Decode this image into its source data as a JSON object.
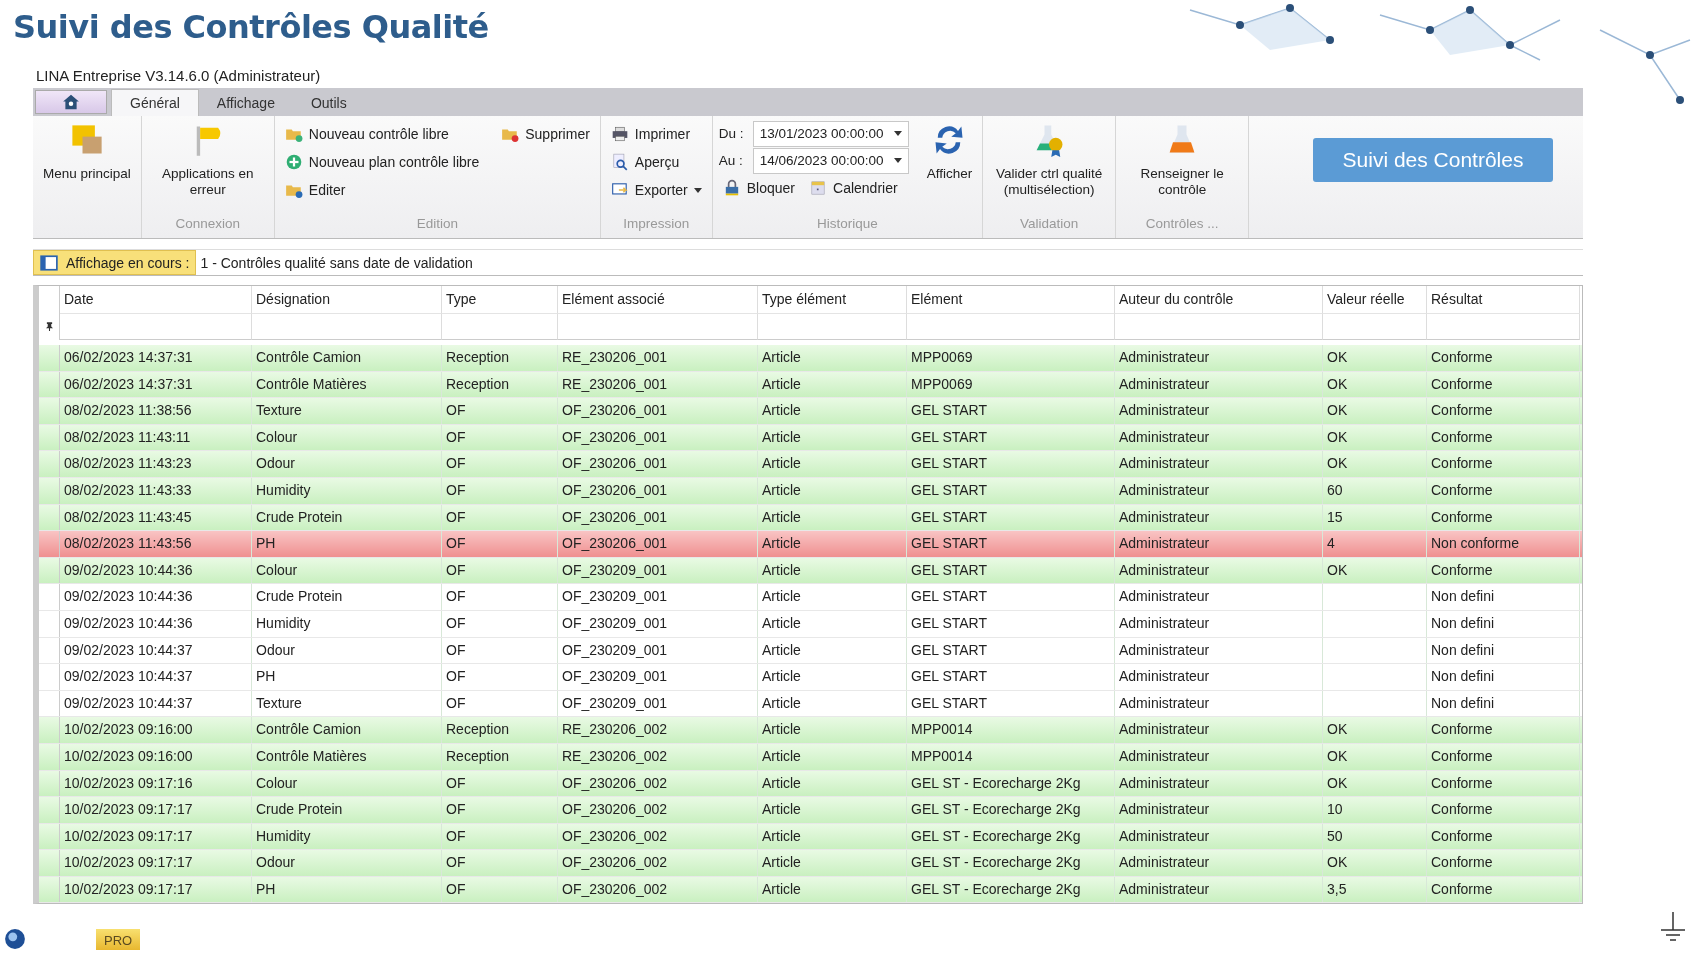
{
  "slide_title": "Suivi des Contrôles Qualité",
  "window": {
    "title": "LINA Entreprise  V3.14.6.0  (Administrateur)"
  },
  "tabs": [
    {
      "label": "Général",
      "selected": true
    },
    {
      "label": "Affichage",
      "selected": false
    },
    {
      "label": "Outils",
      "selected": false
    }
  ],
  "ribbon": {
    "groups": [
      {
        "columns": [
          [
            {
              "kind": "large",
              "label": "Menu principal"
            }
          ]
        ]
      },
      {
        "label": "Connexion",
        "columns": [
          [
            {
              "kind": "large",
              "label": "Applications en erreur"
            }
          ]
        ]
      },
      {
        "label": "Edition",
        "columns": [
          [
            {
              "kind": "small",
              "label": "Nouveau contrôle libre"
            },
            {
              "kind": "small",
              "label": "Nouveau plan contrôle libre"
            },
            {
              "kind": "small",
              "label": "Editer"
            }
          ],
          [
            {
              "kind": "small",
              "label": "Supprimer"
            }
          ]
        ]
      },
      {
        "label": "Impression",
        "columns": [
          [
            {
              "kind": "small",
              "label": "Imprimer"
            },
            {
              "kind": "small",
              "label": "Aperçu"
            },
            {
              "kind": "menu",
              "label": "Exporter"
            }
          ]
        ]
      },
      {
        "label": "Historique",
        "columns": [
          [
            {
              "kind": "date",
              "label": "Du :",
              "value": "13/01/2023 00:00:00"
            },
            {
              "kind": "date",
              "label": "Au :",
              "value": "14/06/2023 00:00:00"
            },
            {
              "kind": "row",
              "items": [
                {
                  "kind": "small",
                  "label": "Bloquer"
                },
                {
                  "kind": "small",
                  "label": "Calendrier"
                }
              ]
            }
          ],
          [
            {
              "kind": "large",
              "label": "Afficher"
            }
          ]
        ]
      },
      {
        "label": "Validation",
        "columns": [
          [
            {
              "kind": "large",
              "label": "Valider ctrl qualité (multisélection)"
            }
          ]
        ]
      },
      {
        "label": "Contrôles ...",
        "columns": [
          [
            {
              "kind": "large",
              "label": "Renseigner le contrôle"
            }
          ]
        ]
      }
    ]
  },
  "callout_button": "Suivi des Contrôles",
  "current_view": {
    "label": "Affichage en cours :",
    "value": "1 - Contrôles qualité sans date de validation"
  },
  "table": {
    "columns": [
      "Date",
      "Désignation",
      "Type",
      "Elément associé",
      "Type élément",
      "Elément",
      "Auteur du contrôle",
      "Valeur réelle",
      "Résultat"
    ],
    "rows": [
      {
        "kind": "ok",
        "cells": [
          "06/02/2023 14:37:31",
          "Contrôle Camion",
          "Reception",
          "RE_230206_001",
          "Article",
          "MPP0069",
          "Administrateur",
          "OK",
          "Conforme"
        ]
      },
      {
        "kind": "ok",
        "cells": [
          "06/02/2023 14:37:31",
          "Contrôle Matières",
          "Reception",
          "RE_230206_001",
          "Article",
          "MPP0069",
          "Administrateur",
          "OK",
          "Conforme"
        ]
      },
      {
        "kind": "ok",
        "cells": [
          "08/02/2023 11:38:56",
          "Texture",
          "OF",
          "OF_230206_001",
          "Article",
          "GEL START",
          "Administrateur",
          "OK",
          "Conforme"
        ]
      },
      {
        "kind": "ok",
        "cells": [
          "08/02/2023 11:43:11",
          "Colour",
          "OF",
          "OF_230206_001",
          "Article",
          "GEL START",
          "Administrateur",
          "OK",
          "Conforme"
        ]
      },
      {
        "kind": "ok",
        "cells": [
          "08/02/2023 11:43:23",
          "Odour",
          "OF",
          "OF_230206_001",
          "Article",
          "GEL START",
          "Administrateur",
          "OK",
          "Conforme"
        ]
      },
      {
        "kind": "ok",
        "cells": [
          "08/02/2023 11:43:33",
          "Humidity",
          "OF",
          "OF_230206_001",
          "Article",
          "GEL START",
          "Administrateur",
          "60",
          "Conforme"
        ]
      },
      {
        "kind": "ok",
        "cells": [
          "08/02/2023 11:43:45",
          "Crude Protein",
          "OF",
          "OF_230206_001",
          "Article",
          "GEL START",
          "Administrateur",
          "15",
          "Conforme"
        ]
      },
      {
        "kind": "fail",
        "cells": [
          "08/02/2023 11:43:56",
          "PH",
          "OF",
          "OF_230206_001",
          "Article",
          "GEL START",
          "Administrateur",
          "4",
          "Non conforme"
        ]
      },
      {
        "kind": "ok",
        "cells": [
          "09/02/2023 10:44:36",
          "Colour",
          "OF",
          "OF_230209_001",
          "Article",
          "GEL START",
          "Administrateur",
          "OK",
          "Conforme"
        ]
      },
      {
        "kind": "none",
        "cells": [
          "09/02/2023 10:44:36",
          "Crude Protein",
          "OF",
          "OF_230209_001",
          "Article",
          "GEL START",
          "Administrateur",
          "",
          "Non defini"
        ]
      },
      {
        "kind": "none",
        "cells": [
          "09/02/2023 10:44:36",
          "Humidity",
          "OF",
          "OF_230209_001",
          "Article",
          "GEL START",
          "Administrateur",
          "",
          "Non defini"
        ]
      },
      {
        "kind": "none",
        "cells": [
          "09/02/2023 10:44:37",
          "Odour",
          "OF",
          "OF_230209_001",
          "Article",
          "GEL START",
          "Administrateur",
          "",
          "Non defini"
        ]
      },
      {
        "kind": "none",
        "cells": [
          "09/02/2023 10:44:37",
          "PH",
          "OF",
          "OF_230209_001",
          "Article",
          "GEL START",
          "Administrateur",
          "",
          "Non defini"
        ]
      },
      {
        "kind": "none",
        "cells": [
          "09/02/2023 10:44:37",
          "Texture",
          "OF",
          "OF_230209_001",
          "Article",
          "GEL START",
          "Administrateur",
          "",
          "Non defini"
        ]
      },
      {
        "kind": "ok",
        "cells": [
          "10/02/2023 09:16:00",
          "Contrôle Camion",
          "Reception",
          "RE_230206_002",
          "Article",
          "MPP0014",
          "Administrateur",
          "OK",
          "Conforme"
        ]
      },
      {
        "kind": "ok",
        "cells": [
          "10/02/2023 09:16:00",
          "Contrôle Matières",
          "Reception",
          "RE_230206_002",
          "Article",
          "MPP0014",
          "Administrateur",
          "OK",
          "Conforme"
        ]
      },
      {
        "kind": "ok",
        "cells": [
          "10/02/2023 09:17:16",
          "Colour",
          "OF",
          "OF_230206_002",
          "Article",
          "GEL ST - Ecorecharge 2Kg",
          "Administrateur",
          "OK",
          "Conforme"
        ]
      },
      {
        "kind": "ok",
        "cells": [
          "10/02/2023 09:17:17",
          "Crude Protein",
          "OF",
          "OF_230206_002",
          "Article",
          "GEL ST - Ecorecharge 2Kg",
          "Administrateur",
          "10",
          "Conforme"
        ]
      },
      {
        "kind": "ok",
        "cells": [
          "10/02/2023 09:17:17",
          "Humidity",
          "OF",
          "OF_230206_002",
          "Article",
          "GEL ST - Ecorecharge 2Kg",
          "Administrateur",
          "50",
          "Conforme"
        ]
      },
      {
        "kind": "ok",
        "cells": [
          "10/02/2023 09:17:17",
          "Odour",
          "OF",
          "OF_230206_002",
          "Article",
          "GEL ST - Ecorecharge 2Kg",
          "Administrateur",
          "OK",
          "Conforme"
        ]
      },
      {
        "kind": "ok",
        "cells": [
          "10/02/2023 09:17:17",
          "PH",
          "OF",
          "OF_230206_002",
          "Article",
          "GEL ST - Ecorecharge 2Kg",
          "Administrateur",
          "3,5",
          "Conforme"
        ]
      }
    ]
  },
  "footer_logo": "PRO"
}
